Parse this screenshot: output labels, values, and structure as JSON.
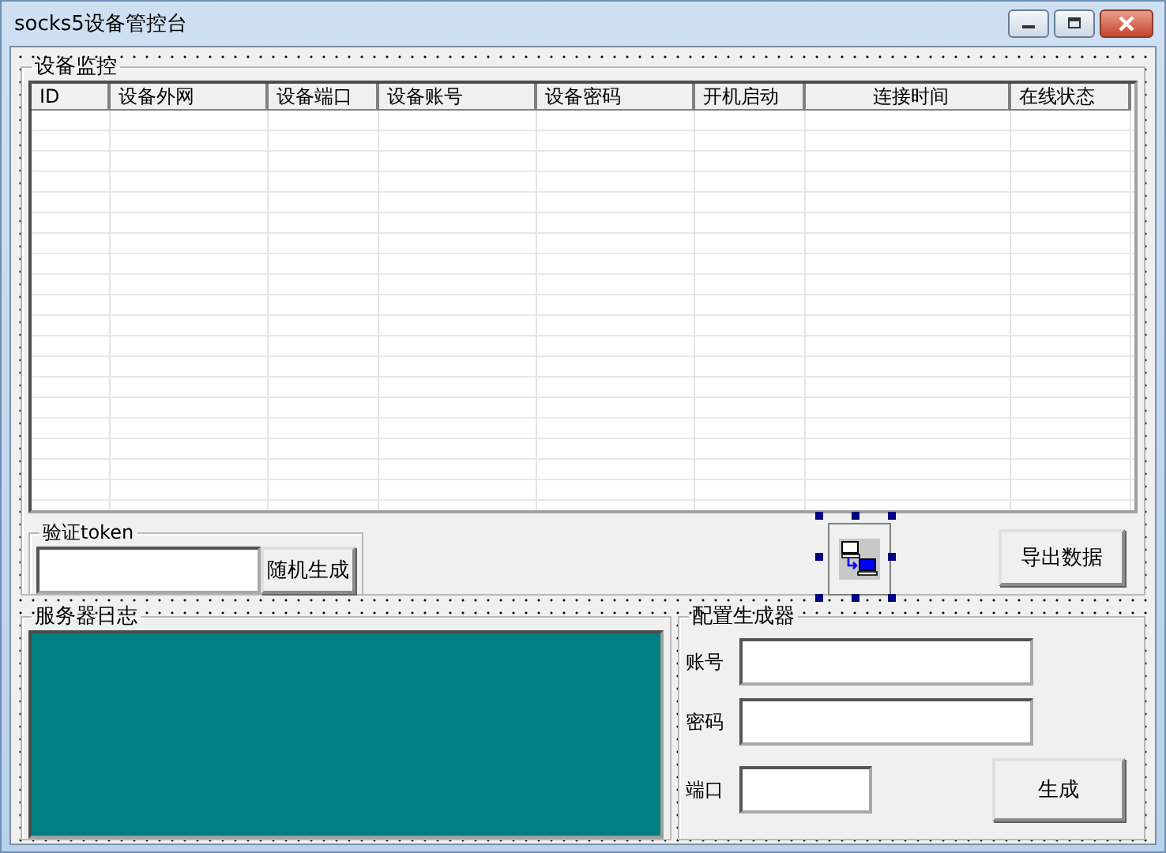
{
  "window": {
    "title": "socks5设备管控台"
  },
  "device_monitor": {
    "title": "设备监控",
    "table": {
      "columns": [
        "ID",
        "设备外网",
        "设备端口",
        "设备账号",
        "设备密码",
        "开机启动",
        "连接时间",
        "在线状态"
      ]
    }
  },
  "token": {
    "title": "验证token",
    "random_button": "随机生成"
  },
  "export_button": "导出数据",
  "server_log": {
    "title": "服务器日志"
  },
  "config_generator": {
    "title": "配置生成器",
    "fields": [
      {
        "label": "账号",
        "kind": "wide"
      },
      {
        "label": "密码",
        "kind": "wide"
      },
      {
        "label": "端口",
        "kind": "narrow"
      }
    ],
    "generate_button": "生成"
  }
}
